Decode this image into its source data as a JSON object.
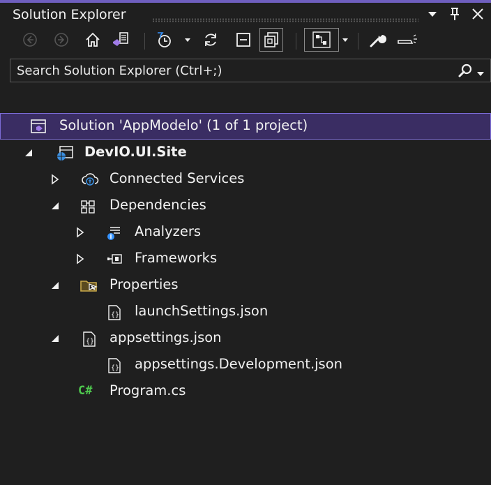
{
  "window": {
    "title": "Solution Explorer"
  },
  "search": {
    "placeholder": "Search Solution Explorer (Ctrl+;)"
  },
  "tree": {
    "solution": "Solution 'AppModelo' (1 of 1 project)",
    "project": "DevIO.UI.Site",
    "connected_services": "Connected Services",
    "dependencies": "Dependencies",
    "analyzers": "Analyzers",
    "frameworks": "Frameworks",
    "properties": "Properties",
    "launch_settings": "launchSettings.json",
    "appsettings": "appsettings.json",
    "appsettings_dev": "appsettings.Development.json",
    "program": "Program.cs",
    "csharp_glyph": "C#"
  },
  "colors": {
    "accent": "#6f5fbf",
    "selection_bg": "#3a2d63",
    "panel_bg": "#1f1f1f",
    "csharp_green": "#4ec94e",
    "globe_blue": "#3b8fe0",
    "info_blue": "#3794ff"
  }
}
